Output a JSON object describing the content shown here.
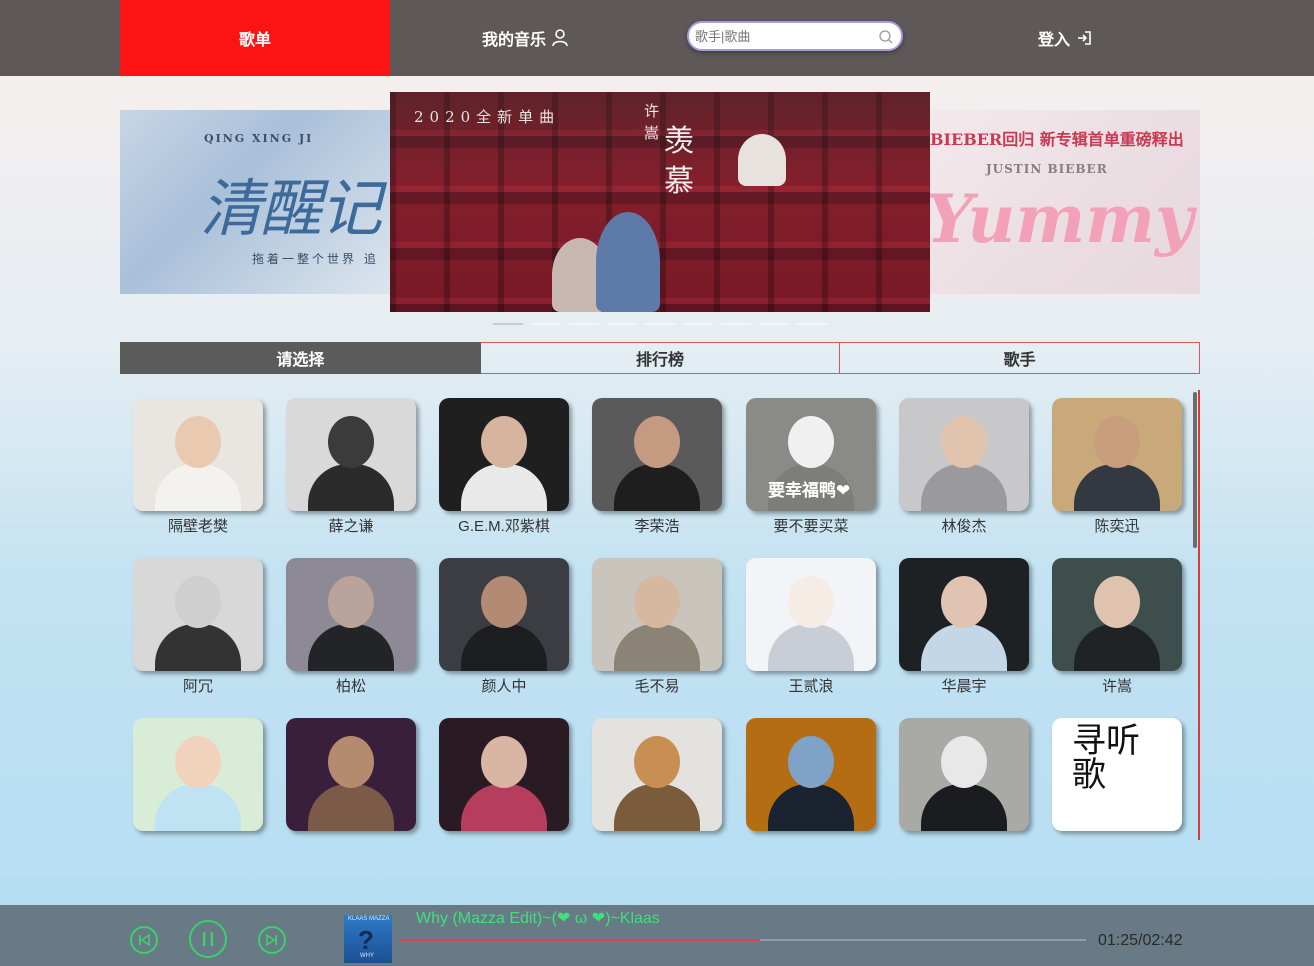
{
  "header": {
    "nav_songlist": "歌单",
    "nav_mymusic": "我的音乐",
    "search_placeholder": "歌手|歌曲",
    "nav_login": "登入"
  },
  "carousel": {
    "left": {
      "sub": "QING XING JI",
      "title": "清醒记",
      "line": "拖着一整个世界 追"
    },
    "center": {
      "tag": "2020全新单曲",
      "artist": "许嵩",
      "song": "羡慕"
    },
    "right": {
      "head": "BIEBER回归  新专辑首单重磅释出",
      "artist": "JUSTIN BIEBER",
      "title": "Yummy"
    },
    "dot_count": 9,
    "active_index": 0
  },
  "tabs": [
    "请选择",
    "排行榜",
    "歌手"
  ],
  "artists": [
    {
      "name": "隔壁老樊",
      "bg": "#e9e6e2",
      "skin": "#e9c9b0",
      "cloth": "#f4f2ee"
    },
    {
      "name": "薛之谦",
      "bg": "#d9d9d9",
      "skin": "#3b3b3b",
      "cloth": "#2b2b2b"
    },
    {
      "name": "G.E.M.邓紫棋",
      "bg": "#1f1f1f",
      "skin": "#d7b49e",
      "cloth": "#e9e9e9"
    },
    {
      "name": "李荣浩",
      "bg": "#5a5a5a",
      "skin": "#c49a80",
      "cloth": "#1e1e1e"
    },
    {
      "name": "要不要买菜",
      "bg": "#8a8a86",
      "skin": "#f0f0f0",
      "cloth": "#7d7d79",
      "overlay": "要幸福鸭❤"
    },
    {
      "name": "林俊杰",
      "bg": "#c8c7c9",
      "skin": "#e0c4ad",
      "cloth": "#9a9a9c"
    },
    {
      "name": "陈奕迅",
      "bg": "#c9a97a",
      "skin": "#c79d7c",
      "cloth": "#343840"
    },
    {
      "name": "阿冗",
      "bg": "#d8d8d8",
      "skin": "#cfcfcf",
      "cloth": "#333333"
    },
    {
      "name": "柏松",
      "bg": "#8e8a95",
      "skin": "#b9a39a",
      "cloth": "#222428"
    },
    {
      "name": "颜人中",
      "bg": "#3b3d42",
      "skin": "#b38b74",
      "cloth": "#1d1e22"
    },
    {
      "name": "毛不易",
      "bg": "#c9c5bd",
      "skin": "#d6b7a0",
      "cloth": "#8b8476"
    },
    {
      "name": "王贰浪",
      "bg": "#f2f4f7",
      "skin": "#f5ece6",
      "cloth": "#c9cdd6"
    },
    {
      "name": "华晨宇",
      "bg": "#1e2124",
      "skin": "#e0c3b0",
      "cloth": "#c3d7e6"
    },
    {
      "name": "许嵩",
      "bg": "#3e4e4c",
      "skin": "#dfc3ae",
      "cloth": "#1f2326"
    },
    {
      "name": "",
      "bg": "#d8ecd7",
      "skin": "#f1d3bd",
      "cloth": "#bfe3f2"
    },
    {
      "name": "",
      "bg": "#3a1f3d",
      "skin": "#b58b6f",
      "cloth": "#7b5a48"
    },
    {
      "name": "",
      "bg": "#2a1a24",
      "skin": "#d8b6a3",
      "cloth": "#b73d5f"
    },
    {
      "name": "",
      "bg": "#e4e2de",
      "skin": "#c98f52",
      "cloth": "#7a5b3c"
    },
    {
      "name": "",
      "bg": "#b56d14",
      "skin": "#7fa3c6",
      "cloth": "#1b2230"
    },
    {
      "name": "",
      "bg": "#a9aaa6",
      "skin": "#e8e8e8",
      "cloth": "#1b1c1f"
    },
    {
      "name": "",
      "bg": "#ffffff",
      "skin": "#ffffff",
      "cloth": "#ffffff",
      "calligraphy": "寻听歌"
    }
  ],
  "player": {
    "song": "Why (Mazza Edit)~(❤ ω ❤)~Klaas",
    "current": "01:25",
    "total": "02:42",
    "time_text": "01:25/02:42",
    "progress": 0.525,
    "cover_label": "KLAAS MAZZA",
    "cover_label2": "WHY",
    "accent": "#3fe07a"
  }
}
